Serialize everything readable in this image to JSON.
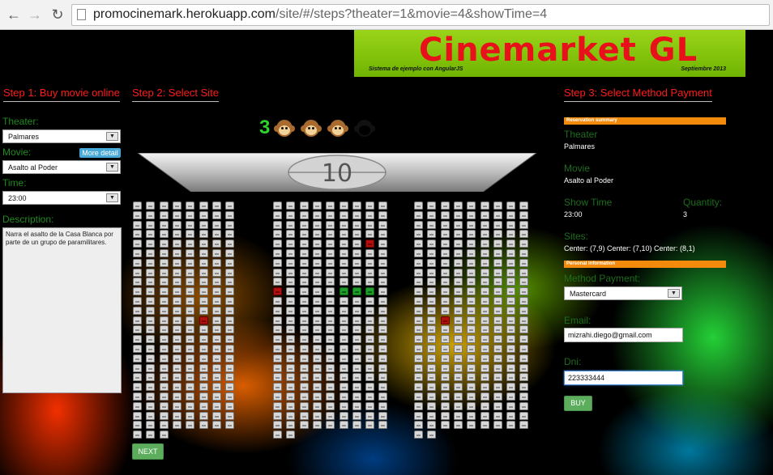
{
  "browser": {
    "url_host": "promocinemark.herokuapp.com",
    "url_path": "/site/#/steps?theater=1&movie=4&showTime=4"
  },
  "banner": {
    "title": "Cinemarket GL",
    "subtitle": "Sistema de ejemplo con AngularJS",
    "date": "Septiembre 2013"
  },
  "step1": {
    "heading": "Step 1: Buy movie online",
    "theater_label": "Theater:",
    "theater_value": "Palmares",
    "movie_label": "Movie:",
    "more_detail": "More detail",
    "movie_value": "Asalto al Poder",
    "time_label": "Time:",
    "time_value": "23:00",
    "description_label": "Description:",
    "description": "Narra el asalto de la Casa Blanca por parte de un grupo de paramilitares."
  },
  "step2": {
    "heading": "Step 2: Select Site",
    "remaining_count": "3",
    "tickets": [
      {
        "icon": "monkey-icon",
        "state": "filled"
      },
      {
        "icon": "monkey-icon",
        "state": "filled"
      },
      {
        "icon": "monkey-icon",
        "state": "filled"
      },
      {
        "icon": "monkey-icon",
        "state": "empty"
      }
    ],
    "screen_label": "10",
    "next_button": "NEXT",
    "seat_map": {
      "blocks": [
        {
          "name": "left",
          "cols": 8,
          "rows": 24,
          "extra_bottom": [
            {
              "row": 24,
              "cols": [
                0,
                1,
                2
              ]
            }
          ],
          "occupied": [
            [
              12,
              5
            ]
          ],
          "selected": []
        },
        {
          "name": "center",
          "cols": 9,
          "rows": 24,
          "extra_bottom": [
            {
              "row": 24,
              "cols": [
                0,
                1
              ]
            }
          ],
          "occupied": [
            [
              4,
              7
            ],
            [
              9,
              0
            ]
          ],
          "selected": [
            [
              9,
              5
            ],
            [
              9,
              6
            ],
            [
              9,
              7
            ]
          ]
        },
        {
          "name": "right",
          "cols": 9,
          "rows": 24,
          "extra_bottom": [
            {
              "row": 24,
              "cols": [
                0,
                1
              ]
            }
          ],
          "occupied": [
            [
              12,
              2
            ]
          ],
          "selected": []
        }
      ]
    }
  },
  "step3": {
    "heading": "Step 3: Select Method Payment",
    "reservation_summary": "Reservation summary",
    "theater_label": "Theater",
    "theater_value": "Palmares",
    "movie_label": "Movie",
    "movie_value": "Asalto al Poder",
    "showtime_label": "Show Time",
    "showtime_value": "23:00",
    "quantity_label": "Quantity:",
    "quantity_value": "3",
    "sites_label": "Sites:",
    "sites_value": "Center: (7,9) Center: (7,10) Center: (8,1)",
    "personal_information": "Personal information",
    "payment_label": "Method Payment:",
    "payment_value": "Mastercard",
    "email_label": "Email:",
    "email_value": "mizrahi.diego@gmail.com",
    "dni_label": "Dni:",
    "dni_value": "223333444",
    "buy_button": "BUY"
  },
  "colors": {
    "step_heading": "#ff1a1a",
    "label_green": "#1f8a1f",
    "seat_free": "#d8d8d8",
    "seat_occupied": "#b01010",
    "seat_selected": "#1e9d2a",
    "section_header": "#f38a0c"
  }
}
